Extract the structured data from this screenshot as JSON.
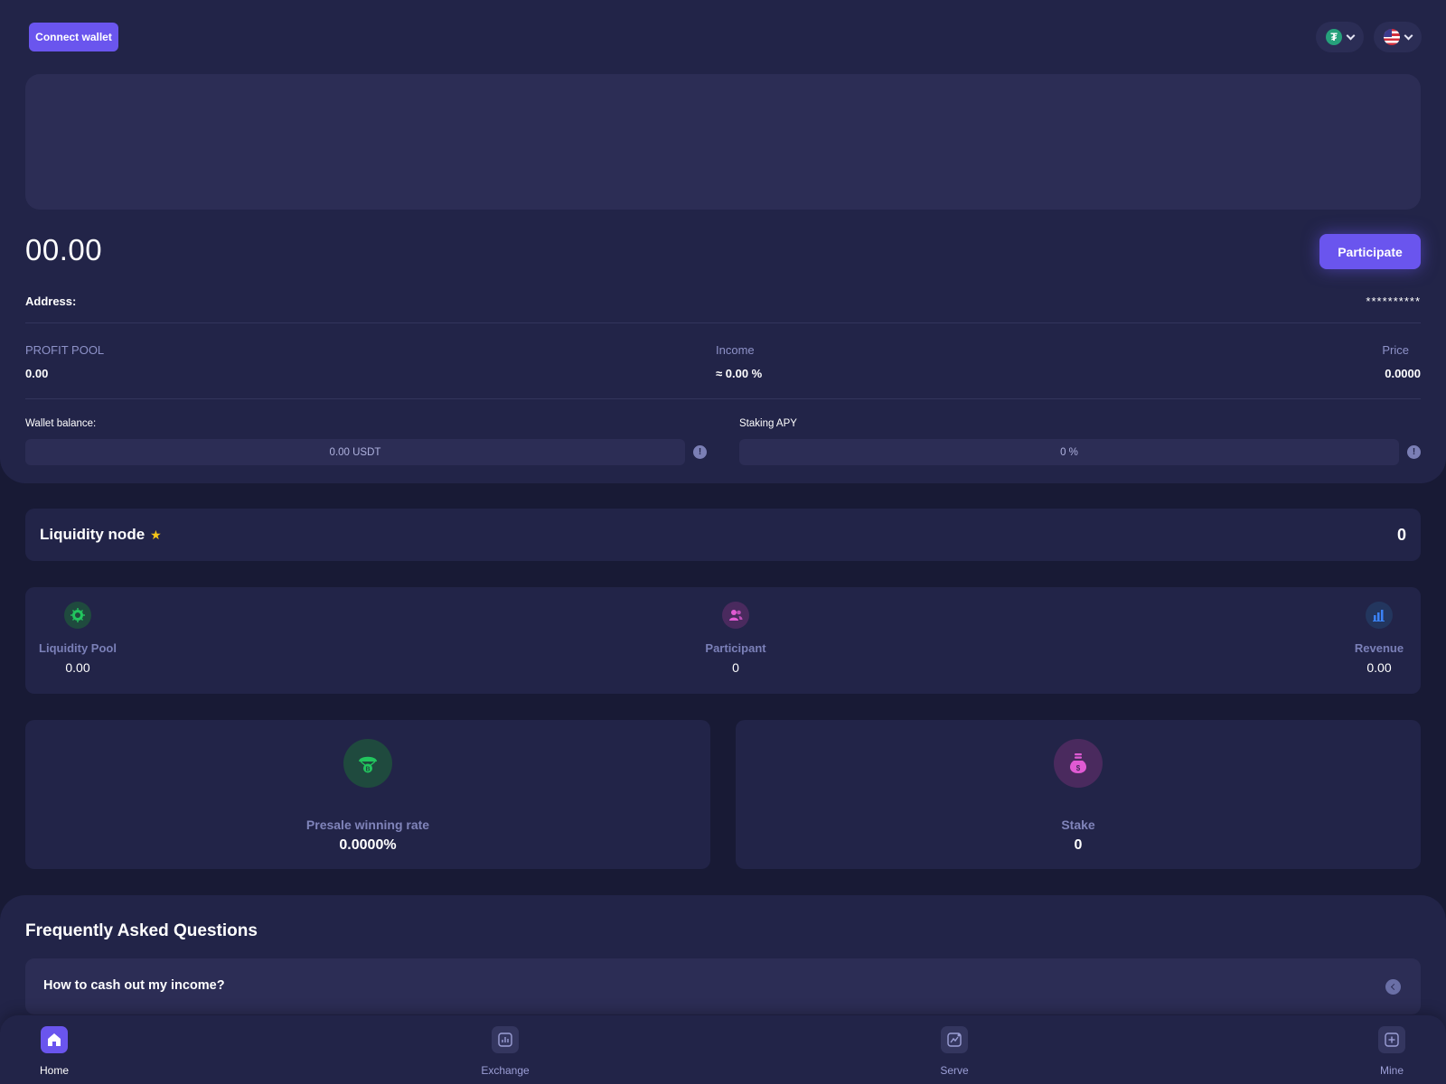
{
  "header": {
    "connect_label": "Connect wallet",
    "token_icon": "tether-icon",
    "language_icon": "us-flag-icon"
  },
  "summary": {
    "amount": "00.00",
    "participate_label": "Participate",
    "address_label": "Address:",
    "address_value": "**********"
  },
  "stats": [
    {
      "label": "PROFIT POOL",
      "value": "0.00"
    },
    {
      "label": "Income",
      "value": "≈ 0.00 %"
    },
    {
      "label": "Price",
      "value": "0.0000"
    }
  ],
  "wallet": {
    "label": "Wallet balance:",
    "value": "0.00 USDT"
  },
  "staking": {
    "label": "Staking APY",
    "value": "0 %"
  },
  "node": {
    "title": "Liquidity node",
    "value": "0"
  },
  "pool": [
    {
      "label": "Liquidity Pool",
      "value": "0.00",
      "icon": "chip-icon",
      "color": "#22c55e"
    },
    {
      "label": "Participant",
      "value": "0",
      "icon": "users-icon",
      "color": "#e05ad3"
    },
    {
      "label": "Revenue",
      "value": "0.00",
      "icon": "bar-chart-icon",
      "color": "#3b82f6"
    }
  ],
  "features": [
    {
      "label": "Presale winning rate",
      "value": "0.0000%",
      "icon": "airdrop-icon",
      "color": "#22c55e"
    },
    {
      "label": "Stake",
      "value": "0",
      "icon": "money-bag-icon",
      "color": "#e05ad3"
    }
  ],
  "faq": {
    "title": "Frequently Asked Questions",
    "items": [
      {
        "question": "How to cash out my income?"
      }
    ]
  },
  "nav": [
    {
      "label": "Home",
      "icon": "home-icon",
      "active": true
    },
    {
      "label": "Exchange",
      "icon": "exchange-icon",
      "active": false
    },
    {
      "label": "Serve",
      "icon": "serve-icon",
      "active": false
    },
    {
      "label": "Mine",
      "icon": "mine-icon",
      "active": false
    }
  ],
  "colors": {
    "background": "#181a35",
    "card": "#222448",
    "accent": "#6a55ee",
    "muted_text": "#8e92c8"
  }
}
